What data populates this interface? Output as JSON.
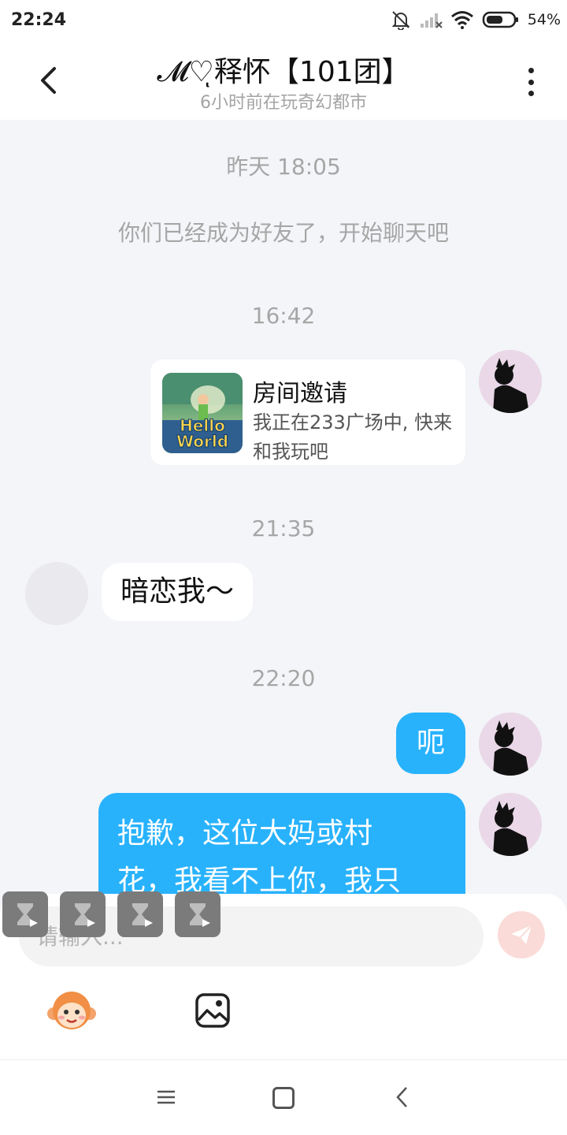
{
  "status": {
    "time": "22:24",
    "battery": "54%"
  },
  "header": {
    "title": "𝓜♡ͅ释怀【101团】",
    "subtitle": "6小时前在玩奇幻都市"
  },
  "messages": {
    "ts1": "昨天 18:05",
    "system": "你们已经成为好友了，开始聊天吧",
    "ts2": "16:42",
    "invite": {
      "title": "房间邀请",
      "desc": "我正在233广场中, 快来和我玩吧",
      "thumb_text_1": "Hello",
      "thumb_text_2": "World"
    },
    "ts3": "21:35",
    "incoming": "暗恋我～",
    "ts4": "22:20",
    "out1": "呃",
    "out2_line1": "抱歉，这位大妈或村",
    "out2_line2": "花，我看不上你，我只"
  },
  "input": {
    "placeholder": "请输入..."
  },
  "colors": {
    "accent": "#28b2fc",
    "background": "#f3f5f8",
    "send_disabled": "#fadbd7"
  }
}
